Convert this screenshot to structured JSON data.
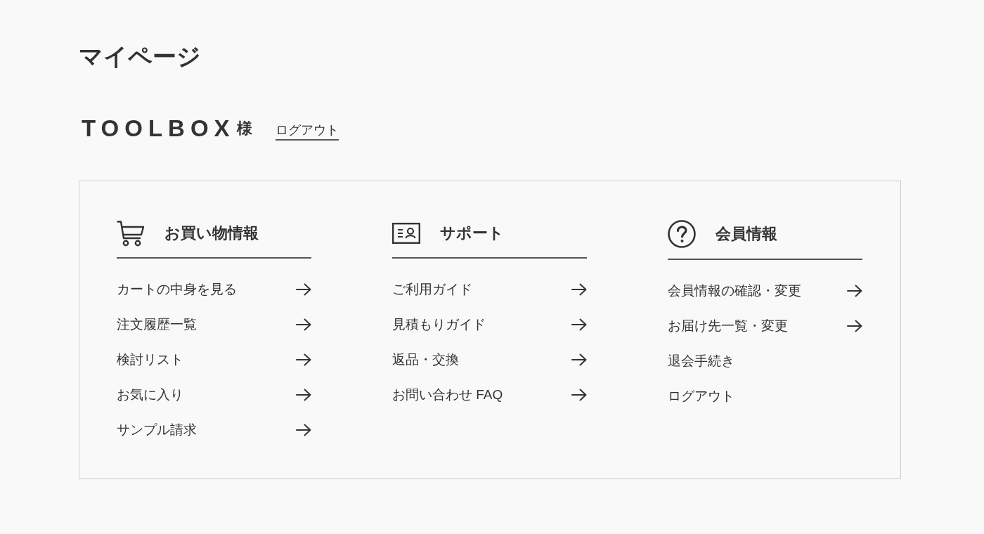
{
  "page_title": "マイページ",
  "user": {
    "name": "TOOLBOX",
    "honorific": "様",
    "logout_link": "ログアウト"
  },
  "sections": [
    {
      "kind": "shopping",
      "title": "お買い物情報",
      "items": [
        {
          "label": "カートの中身を見る",
          "arrow": true
        },
        {
          "label": "注文履歴一覧",
          "arrow": true
        },
        {
          "label": "検討リスト",
          "arrow": true
        },
        {
          "label": "お気に入り",
          "arrow": true
        },
        {
          "label": "サンプル請求",
          "arrow": true
        }
      ]
    },
    {
      "kind": "support",
      "title": "サポート",
      "items": [
        {
          "label": "ご利用ガイド",
          "arrow": true
        },
        {
          "label": "見積もりガイド",
          "arrow": true
        },
        {
          "label": "返品・交換",
          "arrow": true
        },
        {
          "label": "お問い合わせ FAQ",
          "arrow": true
        }
      ]
    },
    {
      "kind": "member",
      "title": "会員情報",
      "items": [
        {
          "label": "会員情報の確認・変更",
          "arrow": true
        },
        {
          "label": "お届け先一覧・変更",
          "arrow": true
        },
        {
          "label": "退会手続き",
          "arrow": false
        },
        {
          "label": "ログアウト",
          "arrow": false
        }
      ]
    }
  ]
}
